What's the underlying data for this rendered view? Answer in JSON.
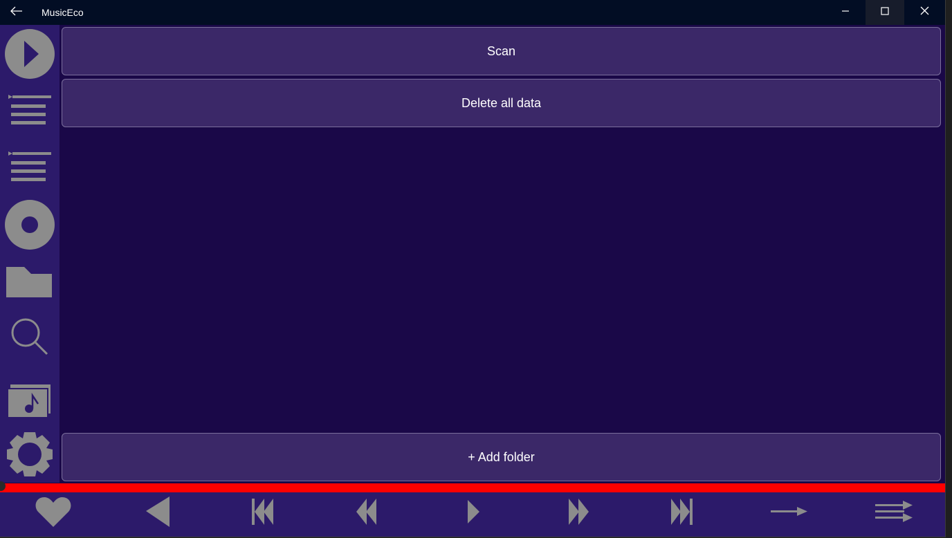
{
  "window": {
    "title": "MusicEco"
  },
  "colors": {
    "titlebar": "#020d24",
    "sidebar": "#2c1a6a",
    "content_bg": "#1a0848",
    "button_bg": "#3b2868",
    "button_border": "#7b6f9c",
    "icon": "#8c8c8c",
    "progress": "#ff0000"
  },
  "titlebar": {
    "back_icon": "arrow-left-icon",
    "minimize_icon": "minimize-icon",
    "maximize_icon": "maximize-icon",
    "close_icon": "close-icon"
  },
  "sidebar": {
    "items": [
      {
        "name": "now-playing",
        "icon": "play-circle-icon"
      },
      {
        "name": "queue",
        "icon": "queue-list-icon"
      },
      {
        "name": "playlists",
        "icon": "playlist-icon"
      },
      {
        "name": "albums",
        "icon": "disc-icon"
      },
      {
        "name": "folders",
        "icon": "folder-icon"
      },
      {
        "name": "search",
        "icon": "search-icon"
      },
      {
        "name": "library",
        "icon": "music-library-icon"
      },
      {
        "name": "settings",
        "icon": "gear-icon"
      }
    ]
  },
  "main": {
    "scan_label": "Scan",
    "delete_label": "Delete all data",
    "add_folder_label": "+ Add folder"
  },
  "progress": {
    "fraction": 1.0
  },
  "player": {
    "controls": [
      "heart-icon",
      "volume-icon",
      "skip-previous-icon",
      "rewind-icon",
      "play-icon",
      "fast-forward-icon",
      "skip-next-icon",
      "repeat-off-icon",
      "shuffle-icon"
    ]
  }
}
